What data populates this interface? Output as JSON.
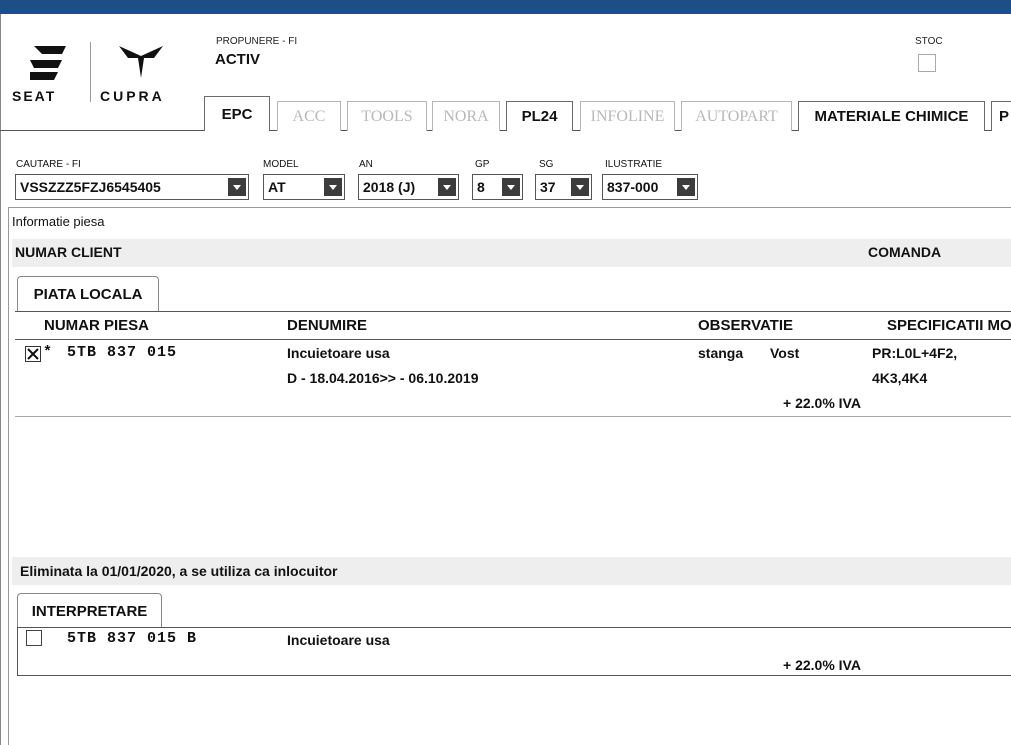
{
  "header": {
    "propunere_label": "PROPUNERE - FI",
    "status": "ACTIV",
    "stoc_label": "STOC",
    "logo_seat": "SEAT",
    "logo_cupra": "CUPRA"
  },
  "tabs": [
    {
      "label": "EPC",
      "state": "active"
    },
    {
      "label": "ACC",
      "state": "disabled"
    },
    {
      "label": "TOOLS",
      "state": "disabled"
    },
    {
      "label": "NORA",
      "state": "disabled"
    },
    {
      "label": "PL24",
      "state": "enabled"
    },
    {
      "label": "INFOLINE",
      "state": "disabled"
    },
    {
      "label": "AUTOPART",
      "state": "disabled"
    },
    {
      "label": "MATERIALE CHIMICE",
      "state": "enabled"
    },
    {
      "label": "P",
      "state": "enabled"
    }
  ],
  "filters": {
    "cautare": {
      "label": "CAUTARE - FI",
      "value": "VSSZZZ5FZJ6545405"
    },
    "model": {
      "label": "MODEL",
      "value": "AT"
    },
    "an": {
      "label": "AN",
      "value": "2018 (J)"
    },
    "gp": {
      "label": "GP",
      "value": "8"
    },
    "sg": {
      "label": "SG",
      "value": "37"
    },
    "ilustratie": {
      "label": "ILUSTRATIE",
      "value": "837-000"
    }
  },
  "panel": {
    "title": "Informatie piesa",
    "numar_client": "NUMAR CLIENT",
    "comanda": "COMANDA"
  },
  "local": {
    "tab": "PIATA LOCALA",
    "columns": [
      "NUMAR PIESA",
      "DENUMIRE",
      "OBSERVATIE",
      "SPECIFICATII MO"
    ],
    "row": {
      "checked": true,
      "marker": "*",
      "part_number": "5TB 837 015",
      "name": "Incuietoare usa",
      "date_range": "D - 18.04.2016>> - 06.10.2019",
      "obs_side": "stanga",
      "obs_type": "Vost",
      "spec_line1": "PR:L0L+4F2,",
      "spec_line2": "4K3,4K4",
      "vat": "+ 22.0% IVA"
    }
  },
  "replacement": {
    "notice": "Eliminata la 01/01/2020, a se utiliza ca inlocuitor",
    "tab": "INTERPRETARE",
    "row": {
      "checked": false,
      "part_number": "5TB 837 015 B",
      "name": "Incuietoare usa",
      "vat": "+ 22.0% IVA"
    }
  }
}
